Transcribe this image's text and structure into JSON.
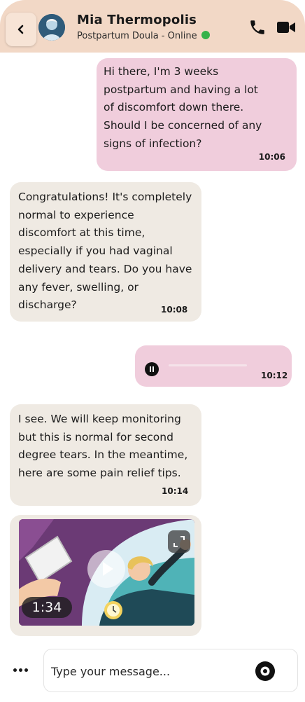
{
  "header": {
    "contact_name": "Mia Thermopolis",
    "contact_status": "Postpartum Doula - Online",
    "online_color": "#36b24a",
    "back_icon": "chevron-left-icon",
    "call_icon": "phone-icon",
    "video_icon": "video-camera-icon"
  },
  "messages": [
    {
      "direction": "outgoing",
      "text": "Hi there, I'm 3 weeks postpartum and having a lot of discomfort down there. Should I be concerned of any signs of infection?",
      "time": "10:06"
    },
    {
      "direction": "incoming",
      "text": "Congratulations! It's completely normal to experience discomfort at this time, especially if you had vaginal delivery and tears. Do you have any fever, swelling, or discharge?",
      "time": "10:08"
    },
    {
      "direction": "outgoing",
      "type": "voice",
      "state_icon": "pause-icon",
      "time": "10:12"
    },
    {
      "direction": "incoming",
      "text": "I see. We will keep monitoring but this is normal for second degree tears. In the meantime, here are some pain relief tips.",
      "time": "10:14"
    },
    {
      "direction": "incoming",
      "type": "video",
      "duration": "1:34",
      "expand_icon": "expand-icon",
      "play_icon": "play-icon"
    }
  ],
  "composer": {
    "placeholder": "Type your message...",
    "value": "",
    "more_icon": "more-dots-icon",
    "record_icon": "record-icon"
  },
  "colors": {
    "header_bg": "#f2d8c6",
    "outgoing_bubble": "#f0cddc",
    "incoming_bubble": "#efeae3"
  }
}
